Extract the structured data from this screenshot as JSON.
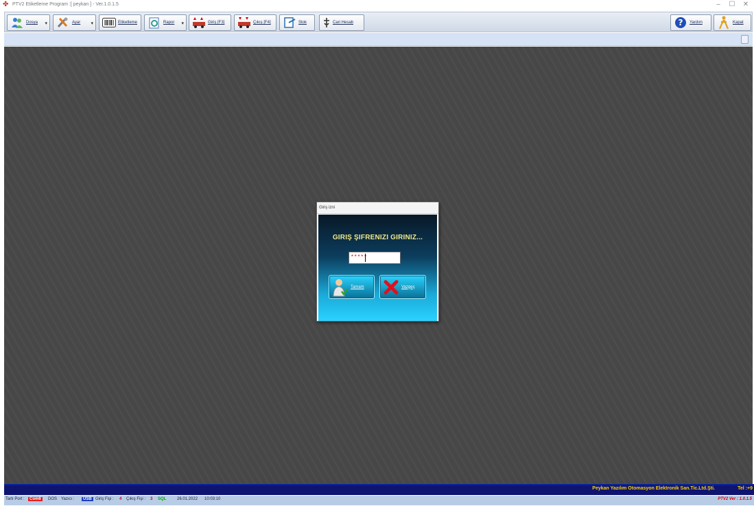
{
  "window": {
    "title": "PTV2 Etiketleme Program :[ peykan ] - Ver.1.0.1.5",
    "controls": [
      "–",
      "☐",
      "✕"
    ]
  },
  "toolbar": {
    "dosya": "Dosya",
    "ayar": "Ayar",
    "etiketleme": "Etiketleme",
    "rapor": "Rapor",
    "giris": "Giriş [F3]",
    "cikis": "Çıkış [F4]",
    "stok": "Stok",
    "cari_hesab": "Cari Hesab",
    "yardim": "Yardım",
    "kapat": "Kapat"
  },
  "dialog": {
    "title": "Giriş izni",
    "prompt": "GIRIŞ ŞIFRENIZI GIRINIZ...",
    "password_value": "*****",
    "ok_label": "Tamam",
    "cancel_label": "Vazgeç"
  },
  "status_top": {
    "company": "Peykan Yazılım Otomasyon Elektronik San.Tic.Ltd.Şti.",
    "tel": "Tel :+9"
  },
  "status_bottom": {
    "tarti_port_label": "Tartı Port :",
    "tarti_port_value": "Com8",
    "dos_label": "DOS",
    "yazici_label": "Yazıcı :",
    "yazici_value": "USB",
    "giris_fisi_label": "Giriş Fişi :",
    "giris_fisi_value": "4",
    "cikis_fisi_label": "Çıkış Fişi :",
    "cikis_fisi_value": "3",
    "db_label": "SQL",
    "date": "26.01.2022",
    "time": "10:03:10",
    "version": "PTV2 Ver : 1.0.1.5"
  },
  "colors": {
    "desktop": "#484848",
    "status_bar": "#0f1470",
    "status_text": "#ffd400",
    "com_badge": "#e0201e",
    "usb_badge": "#1f3fbf",
    "dialog_prompt": "#f0e88a"
  }
}
